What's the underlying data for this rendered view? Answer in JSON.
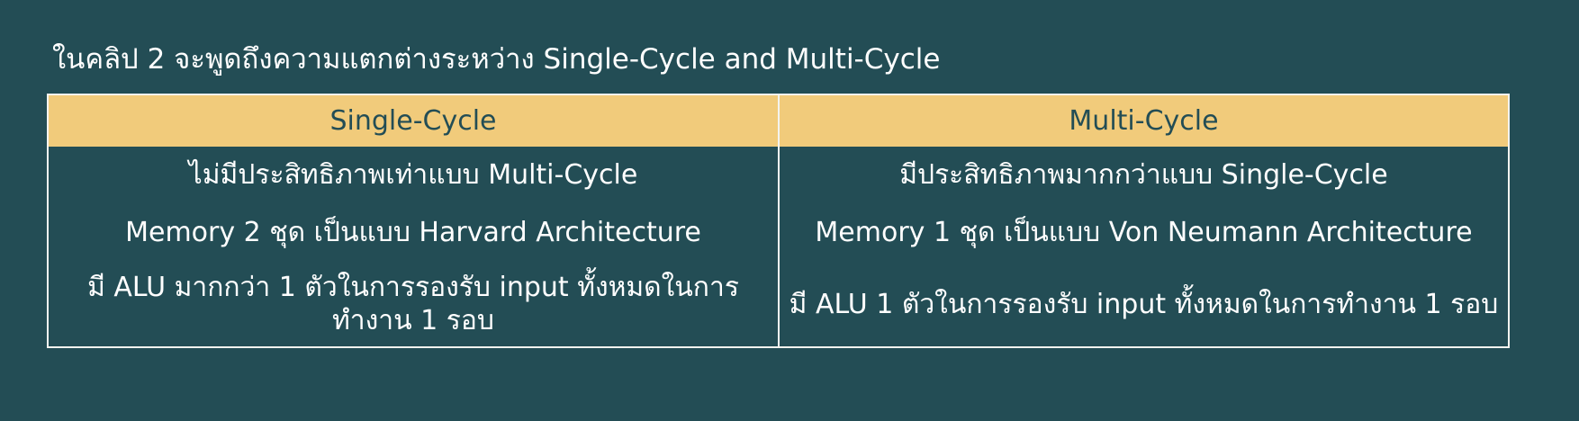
{
  "heading": "ในคลิป 2 จะพูดถึงความแตกต่างระหว่าง Single-Cycle and Multi-Cycle",
  "table": {
    "headers": [
      "Single-Cycle",
      "Multi-Cycle"
    ],
    "rows": [
      [
        "ไม่มีประสิทธิภาพเท่าแบบ Multi-Cycle",
        "มีประสิทธิภาพมากกว่าแบบ Single-Cycle"
      ],
      [
        "Memory 2 ชุด  เป็นแบบ Harvard Architecture",
        "Memory 1 ชุด เป็นแบบ Von Neumann Architecture"
      ],
      [
        "มี ALU มากกว่า 1 ตัวในการรองรับ input ทั้งหมดในการทำงาน 1 รอบ",
        "มี ALU 1 ตัวในการรองรับ input ทั้งหมดในการทำงาน 1 รอบ"
      ]
    ]
  },
  "colors": {
    "background": "#234d55",
    "header_fill": "#f1cb7b",
    "header_text": "#234d55",
    "body_text": "#ffffff",
    "border": "#f3f3ef"
  }
}
